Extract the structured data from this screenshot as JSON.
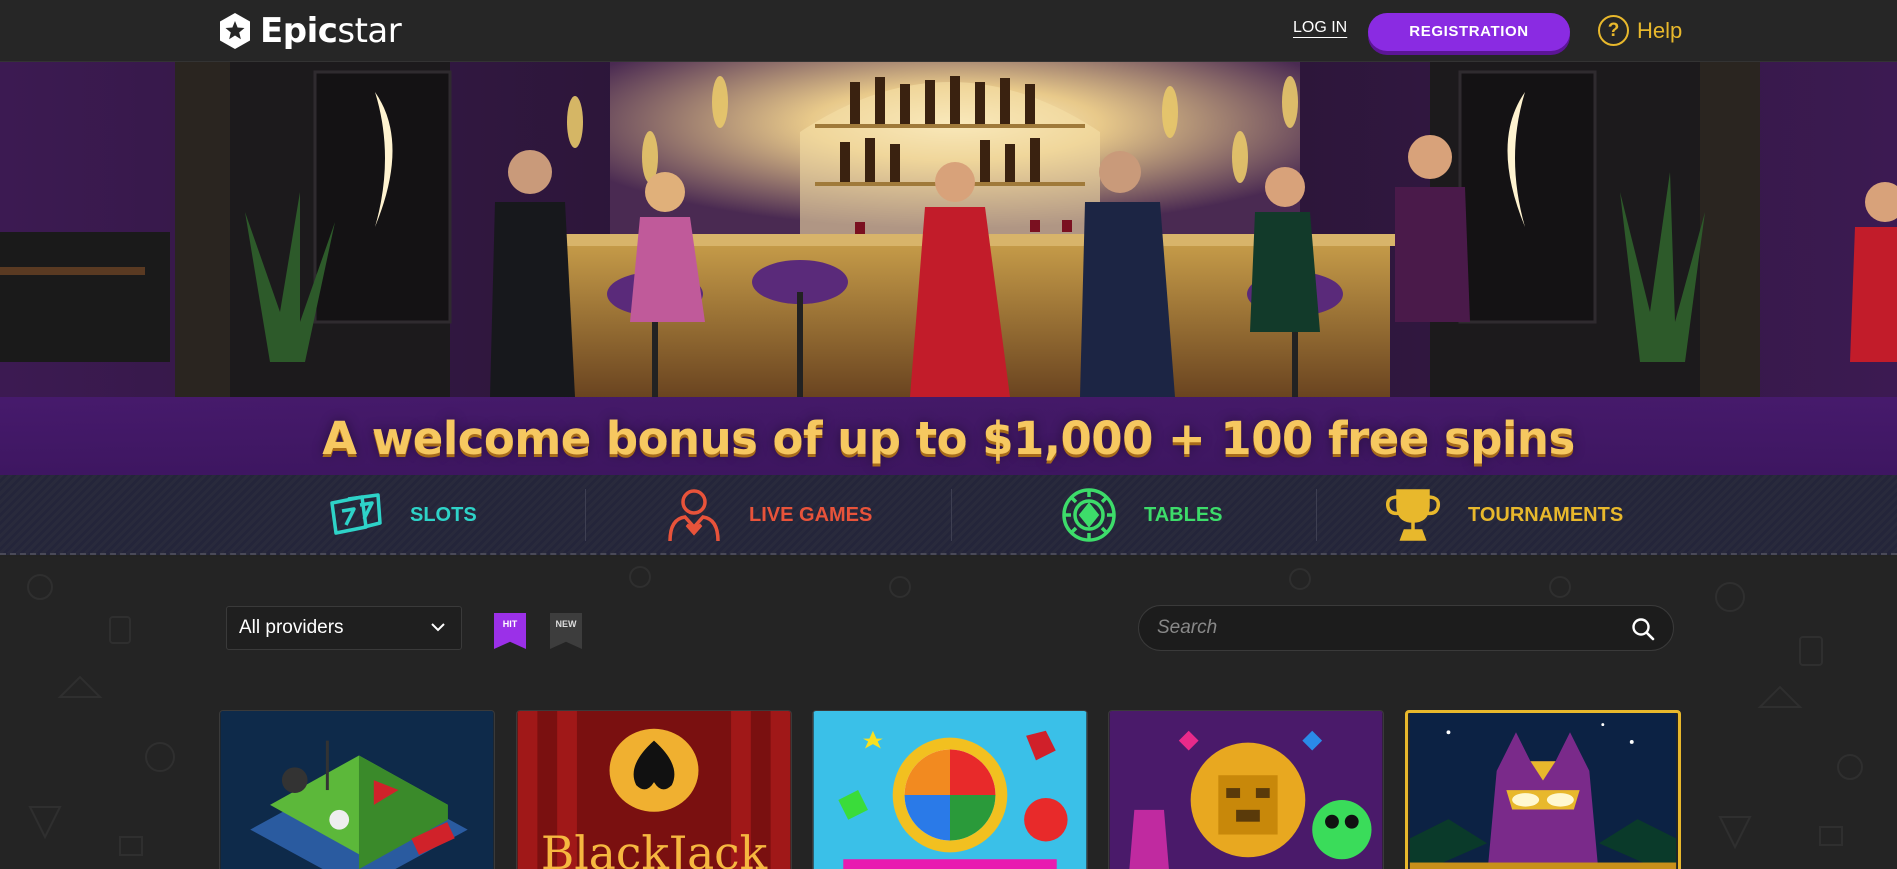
{
  "header": {
    "logo": {
      "bold": "Epic",
      "light": "star",
      "icon": "star-badge-icon"
    },
    "login_label": "LOG IN",
    "registration_label": "REGISTRATION",
    "help_label": "Help",
    "help_icon": "question-circle-icon"
  },
  "hero": {
    "title": "A welcome bonus of up to $1,000 + 100 free spins"
  },
  "categories": [
    {
      "label": "SLOTS",
      "icon": "slot-cherry-icon",
      "color": "#2ed3c8"
    },
    {
      "label": "LIVE GAMES",
      "icon": "dealer-icon",
      "color": "#e8533a"
    },
    {
      "label": "TABLES",
      "icon": "casino-chip-icon",
      "color": "#3ddc6a"
    },
    {
      "label": "TOURNAMENTS",
      "icon": "trophy-icon",
      "color": "#e8b82c"
    }
  ],
  "filters": {
    "provider_selected": "All providers",
    "hit_label": "HIT",
    "new_label": "NEW",
    "search_placeholder": "Search"
  },
  "games": [
    {
      "title": "",
      "art": "golf-isometric"
    },
    {
      "title": "BlackJack",
      "art": "blackjack"
    },
    {
      "title": "",
      "art": "candy-wheel"
    },
    {
      "title": "",
      "art": "aztec-gems"
    },
    {
      "title": "",
      "art": "egyptian-cat"
    }
  ],
  "colors": {
    "accent": "#8a2be2",
    "gold": "#f6c860",
    "header_bg": "#262626"
  }
}
